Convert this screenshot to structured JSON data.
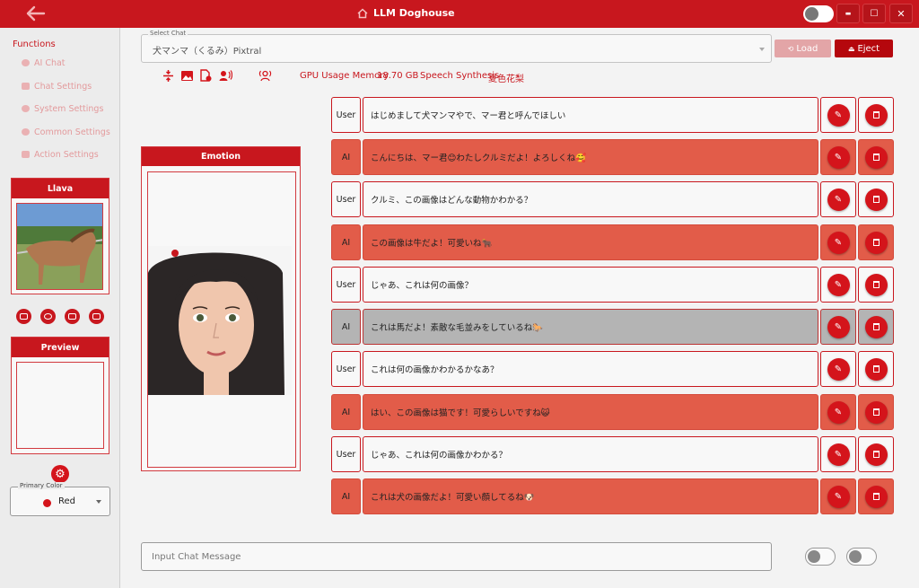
{
  "titlebar": {
    "title": "LLM Doghouse",
    "home_icon": "home-icon",
    "back_icon": "back-arrow-icon",
    "minimize": "▬",
    "maximize": "☐",
    "close": "✕"
  },
  "sidebar": {
    "functions_title": "Functions",
    "items": [
      {
        "label": "AI Chat",
        "icon": "chat-bubble-icon"
      },
      {
        "label": "Chat Settings",
        "icon": "people-icon"
      },
      {
        "label": "System Settings",
        "icon": "gear-icon"
      },
      {
        "label": "Common Settings",
        "icon": "gear-icon"
      },
      {
        "label": "Action Settings",
        "icon": "image-icon"
      }
    ],
    "llava_title": "Llava",
    "preview_title": "Preview",
    "primary_color_label": "Primary Color",
    "primary_color_value": "Red"
  },
  "select_chat": {
    "label": "Select Chat",
    "value": "犬マンマ（くるみ）Pixtral"
  },
  "buttons": {
    "load": "Load",
    "eject": "Eject"
  },
  "status": {
    "gpu_label": "GPU Usage Memory",
    "gpu_value": "18.70 GB",
    "speech_label": "Speech Synthesis",
    "speech_value": "夏色花梨"
  },
  "emotion": {
    "title": "Emotion"
  },
  "messages": [
    {
      "role": "User",
      "text": "はじめまして犬マンマやで、マー君と呼んでほしい"
    },
    {
      "role": "AI",
      "text": "こんにちは、マー君😊わたしクルミだよ！よろしくね🥰"
    },
    {
      "role": "User",
      "text": "クルミ、この画像はどんな動物かわかる？"
    },
    {
      "role": "AI",
      "text": "この画像は牛だよ！可愛いね🐂"
    },
    {
      "role": "User",
      "text": "じゃあ、これは何の画像？"
    },
    {
      "role": "AI",
      "text": "これは馬だよ！素敵な毛並みをしているね🐎"
    },
    {
      "role": "User",
      "text": "これは何の画像かわかるかなあ？"
    },
    {
      "role": "AI",
      "text": "はい、この画像は猫です！可愛らしいですね😺"
    },
    {
      "role": "User",
      "text": "じゃあ、これは何の画像かわかる？"
    },
    {
      "role": "AI",
      "text": "これは犬の画像だよ！可愛い顔してるね🐶"
    }
  ],
  "input": {
    "placeholder": "Input Chat Message"
  },
  "colors": {
    "primary": "#c8171e",
    "ai_row": "#e25c49",
    "selected_row": "#b4b4b4",
    "load_disabled": "#e3a5a7",
    "eject": "#b5070d"
  }
}
